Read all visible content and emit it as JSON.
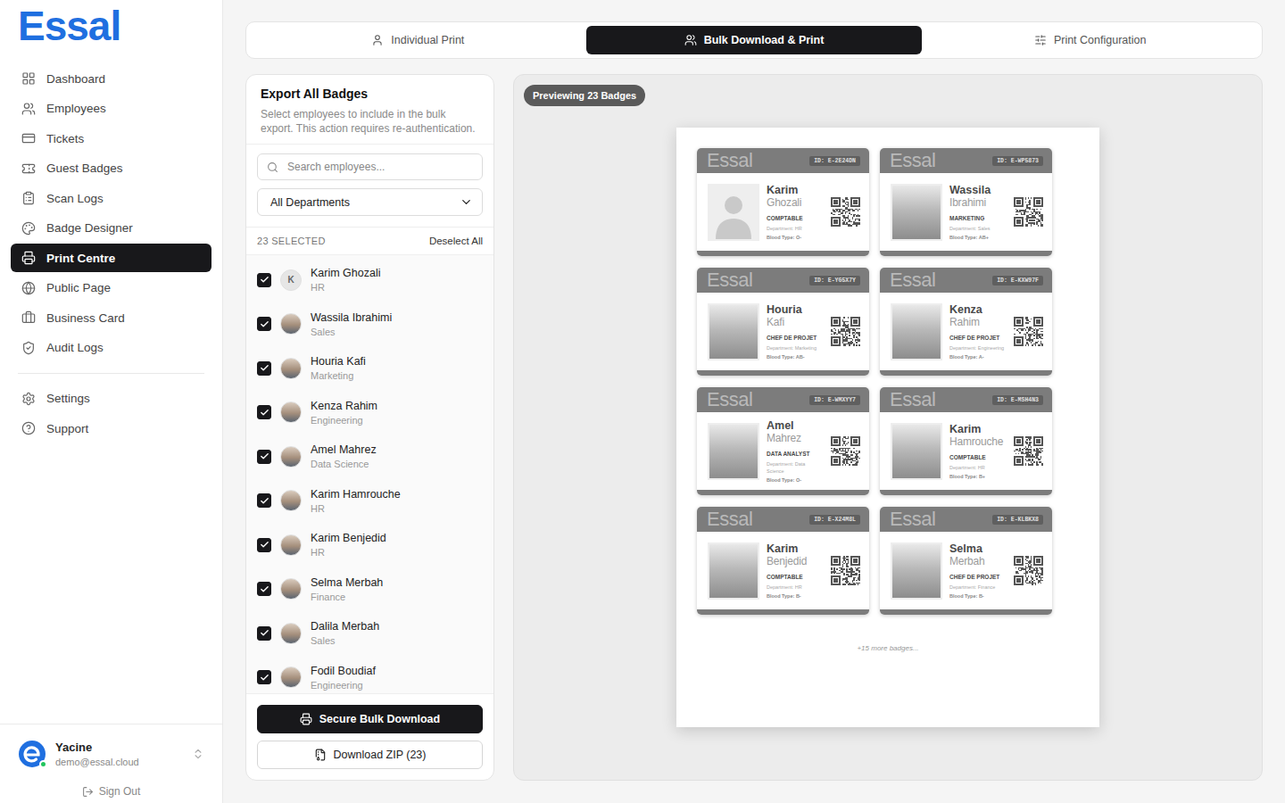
{
  "app": {
    "logo": "Essal"
  },
  "sidebar": {
    "items": [
      {
        "label": "Dashboard",
        "selected": false
      },
      {
        "label": "Employees",
        "selected": false
      },
      {
        "label": "Tickets",
        "selected": false
      },
      {
        "label": "Guest Badges",
        "selected": false
      },
      {
        "label": "Scan Logs",
        "selected": false
      },
      {
        "label": "Badge Designer",
        "selected": false
      },
      {
        "label": "Print Centre",
        "selected": true
      },
      {
        "label": "Public Page",
        "selected": false
      },
      {
        "label": "Business Card",
        "selected": false
      },
      {
        "label": "Audit Logs",
        "selected": false
      }
    ],
    "footer_items": [
      {
        "label": "Settings",
        "selected": false
      },
      {
        "label": "Support",
        "selected": false
      }
    ]
  },
  "user": {
    "name": "Yacine",
    "email": "demo@essal.cloud",
    "online": true
  },
  "sign_out": "Sign Out",
  "tabs": [
    {
      "label": "Individual Print",
      "selected": false
    },
    {
      "label": "Bulk Download & Print",
      "selected": true
    },
    {
      "label": "Print Configuration",
      "selected": false
    }
  ],
  "export_panel": {
    "title": "Export All Badges",
    "description": "Select employees to include in the bulk export. This action requires re-authentication.",
    "search": {
      "placeholder": "Search employees..."
    },
    "department_filter": "All Departments",
    "selected_count": "23 SELECTED",
    "deselect_all": "Deselect All",
    "employees": [
      {
        "name": "Karim Ghozali",
        "department": "HR",
        "checked": true,
        "avatar": {
          "kind": "initial",
          "text": "K"
        }
      },
      {
        "name": "Wassila Ibrahimi",
        "department": "Sales",
        "checked": true,
        "avatar": {
          "kind": "photo"
        }
      },
      {
        "name": "Houria Kafi",
        "department": "Marketing",
        "checked": true,
        "avatar": {
          "kind": "photo"
        }
      },
      {
        "name": "Kenza Rahim",
        "department": "Engineering",
        "checked": true,
        "avatar": {
          "kind": "photo"
        }
      },
      {
        "name": "Amel Mahrez",
        "department": "Data Science",
        "checked": true,
        "avatar": {
          "kind": "photo"
        }
      },
      {
        "name": "Karim Hamrouche",
        "department": "HR",
        "checked": true,
        "avatar": {
          "kind": "photo"
        }
      },
      {
        "name": "Karim Benjedid",
        "department": "HR",
        "checked": true,
        "avatar": {
          "kind": "photo"
        }
      },
      {
        "name": "Selma Merbah",
        "department": "Finance",
        "checked": true,
        "avatar": {
          "kind": "photo"
        }
      },
      {
        "name": "Dalila Merbah",
        "department": "Sales",
        "checked": true,
        "avatar": {
          "kind": "photo"
        }
      },
      {
        "name": "Fodil Boudiaf",
        "department": "Engineering",
        "checked": true,
        "avatar": {
          "kind": "photo"
        }
      }
    ],
    "primary_button": "Secure Bulk Download",
    "secondary_button": "Download ZIP (23)"
  },
  "preview": {
    "label": "Previewing 23 Badges",
    "brand": "Essal",
    "badges": [
      {
        "id": "ID: E-2E24DN",
        "first_name": "Karim",
        "last_name": "Ghozali",
        "role": "COMPTABLE",
        "department": "Department: HR",
        "blood": "Blood Type: O-",
        "photo": {
          "kind": "placeholder"
        }
      },
      {
        "id": "ID: E-WP5873",
        "first_name": "Wassila",
        "last_name": "Ibrahimi",
        "role": "MARKETING",
        "department": "Department: Sales",
        "blood": "Blood Type: AB+",
        "photo": {
          "kind": "photo"
        }
      },
      {
        "id": "ID: E-YG5X7Y",
        "first_name": "Houria",
        "last_name": "Kafi",
        "role": "CHEF DE PROJET",
        "department": "Department: Marketing",
        "blood": "Blood Type: AB-",
        "photo": {
          "kind": "photo"
        }
      },
      {
        "id": "ID: E-KXW97F",
        "first_name": "Kenza",
        "last_name": "Rahim",
        "role": "CHEF DE PROJET",
        "department": "Department: Engineering",
        "blood": "Blood Type: A-",
        "photo": {
          "kind": "photo"
        }
      },
      {
        "id": "ID: E-WMXYY7",
        "first_name": "Amel",
        "last_name": "Mahrez",
        "role": "DATA ANALYST",
        "department": "Department: Data Science",
        "blood": "Blood Type: O-",
        "photo": {
          "kind": "photo"
        }
      },
      {
        "id": "ID: E-MSH4N3",
        "first_name": "Karim",
        "last_name": "Hamrouche",
        "role": "COMPTABLE",
        "department": "Department: HR",
        "blood": "Blood Type: B+",
        "photo": {
          "kind": "photo"
        }
      },
      {
        "id": "ID: E-X24M8L",
        "first_name": "Karim",
        "last_name": "Benjedid",
        "role": "COMPTABLE",
        "department": "Department: HR",
        "blood": "Blood Type: B-",
        "photo": {
          "kind": "photo"
        }
      },
      {
        "id": "ID: E-KLBKX8",
        "first_name": "Selma",
        "last_name": "Merbah",
        "role": "CHEF DE PROJET",
        "department": "Department: Finance",
        "blood": "Blood Type: B-",
        "photo": {
          "kind": "photo"
        }
      }
    ],
    "more": "+15 more badges..."
  }
}
